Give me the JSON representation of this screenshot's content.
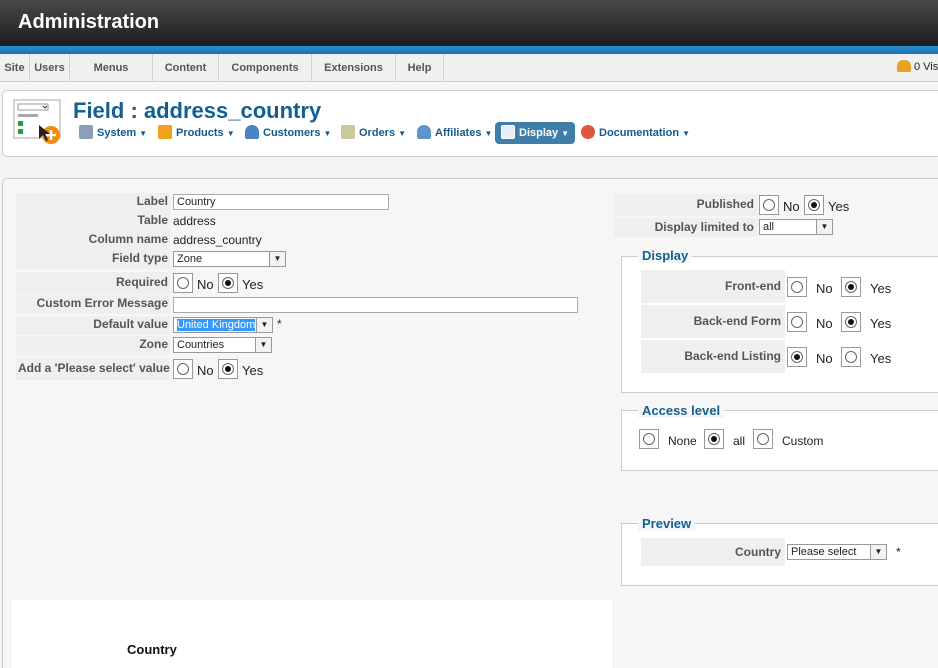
{
  "header": {
    "title": "Administration"
  },
  "menubar": {
    "items": [
      "Site",
      "Users",
      "Menus",
      "Content",
      "Components",
      "Extensions",
      "Help"
    ],
    "visitors": "0 Vis"
  },
  "toolbar": {
    "page_title": "Field : address_country",
    "items": [
      {
        "label": "System",
        "icon": "wrench-icon"
      },
      {
        "label": "Products",
        "icon": "box-icon"
      },
      {
        "label": "Customers",
        "icon": "users-icon"
      },
      {
        "label": "Orders",
        "icon": "orders-icon"
      },
      {
        "label": "Affiliates",
        "icon": "affiliates-icon"
      },
      {
        "label": "Display",
        "icon": "display-icon",
        "active": true
      },
      {
        "label": "Documentation",
        "icon": "lifebuoy-icon"
      }
    ]
  },
  "form": {
    "label": {
      "label": "Label",
      "value": "Country"
    },
    "table": {
      "label": "Table",
      "value": "address"
    },
    "column_name": {
      "label": "Column name",
      "value": "address_country"
    },
    "field_type": {
      "label": "Field type",
      "value": "Zone"
    },
    "required": {
      "label": "Required",
      "no": "No",
      "yes": "Yes"
    },
    "custom_error": {
      "label": "Custom Error Message",
      "value": ""
    },
    "default_value": {
      "label": "Default value",
      "value": "United Kingdom",
      "required_mark": "*"
    },
    "zone": {
      "label": "Zone",
      "value": "Countries"
    },
    "please_select": {
      "label": "Add a 'Please select' value",
      "no": "No",
      "yes": "Yes"
    }
  },
  "right": {
    "published": {
      "label": "Published",
      "no": "No",
      "yes": "Yes"
    },
    "display_limited": {
      "label": "Display limited to",
      "value": "all"
    },
    "display": {
      "legend": "Display",
      "rows": [
        {
          "label": "Front-end",
          "no": "No",
          "yes": "Yes",
          "selected": "yes"
        },
        {
          "label": "Back-end Form",
          "no": "No",
          "yes": "Yes",
          "selected": "yes"
        },
        {
          "label": "Back-end Listing",
          "no": "No",
          "yes": "Yes",
          "selected": "no"
        }
      ]
    },
    "access": {
      "legend": "Access level",
      "none": "None",
      "all": "all",
      "custom": "Custom"
    },
    "preview": {
      "legend": "Preview",
      "label": "Country",
      "value": "Please select",
      "required_mark": "*"
    }
  },
  "preview_panel": {
    "label": "Country"
  }
}
